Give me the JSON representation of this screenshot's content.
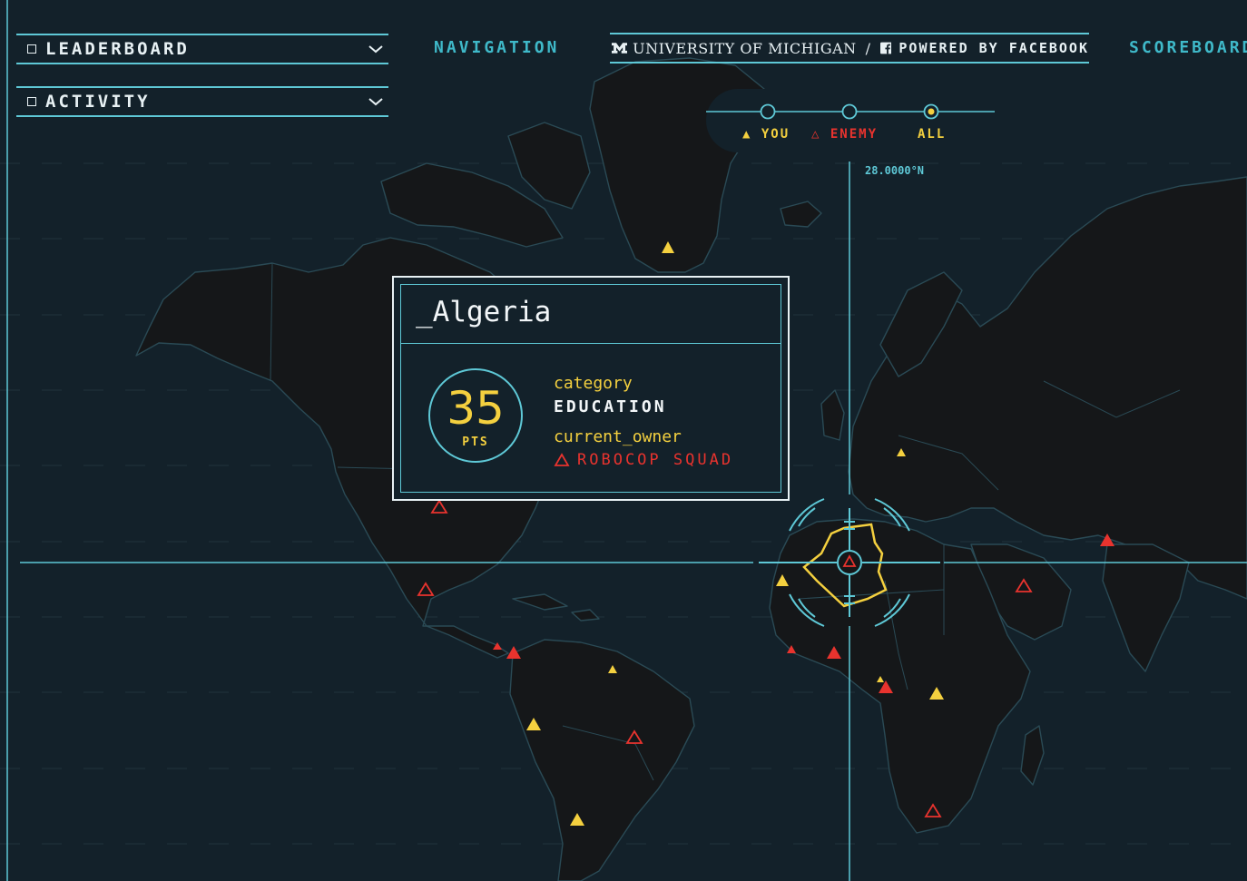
{
  "panels": {
    "leaderboard_label": "LEADERBOARD",
    "activity_label": "ACTIVITY"
  },
  "topnav": {
    "navigation_label": "NAVIGATION",
    "scoreboard_label": "SCOREBOARD",
    "university_label": "UNIVERSITY OF MICHIGAN",
    "separator": "/",
    "powered_label": "POWERED BY FACEBOOK"
  },
  "filters": {
    "you_label": "YOU",
    "enemy_label": "ENEMY",
    "all_label": "ALL",
    "selected": "ALL"
  },
  "coordinate_readout": "28.0000°N",
  "country_card": {
    "name": "_Algeria",
    "points": "35",
    "points_unit": "PTS",
    "category_key": "category",
    "category_value": "EDUCATION",
    "owner_key": "current_owner",
    "owner_value": "ROBOCOP SQUAD"
  },
  "colors": {
    "background": "#13212a",
    "land": "#151719",
    "accent_cyan": "#5ec8d6",
    "you_yellow": "#f4d03f",
    "enemy_red": "#e8332e",
    "text_white": "#e8f1f4"
  },
  "icons": {
    "university_logo": "block-m-icon",
    "facebook_logo": "facebook-icon",
    "you_marker": "filled-triangle-icon",
    "enemy_marker": "outline-triangle-icon",
    "dropdown": "chevron-down-icon",
    "collapse_box": "square-icon",
    "crosshair": "target-reticle-icon"
  }
}
